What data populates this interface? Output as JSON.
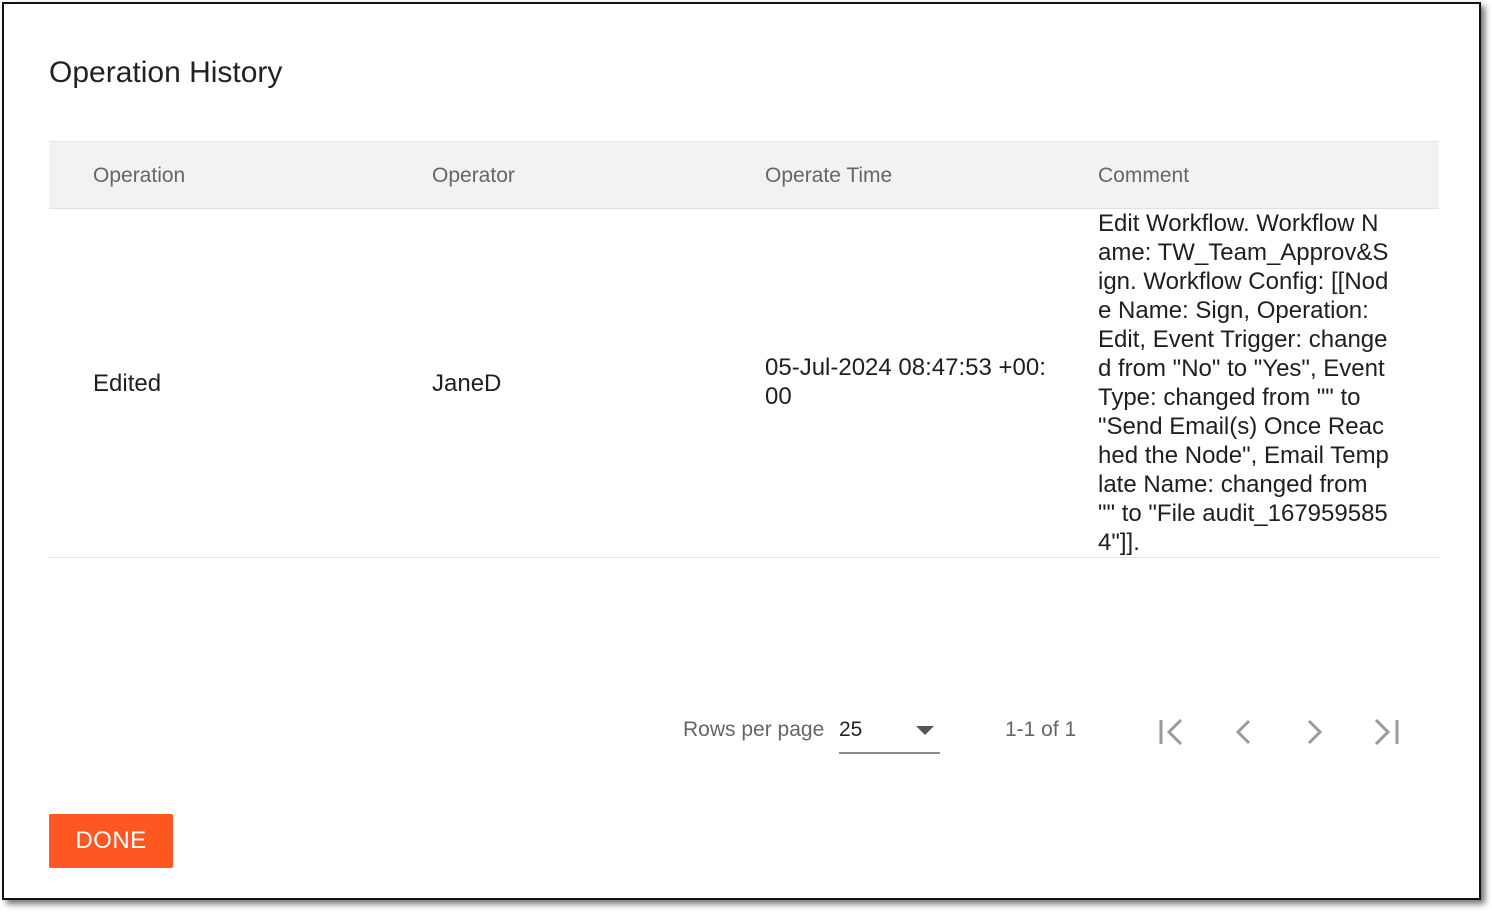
{
  "dialog": {
    "title": "Operation History",
    "done_label": "DONE"
  },
  "table": {
    "columns": [
      "Operation",
      "Operator",
      "Operate Time",
      "Comment"
    ],
    "rows": [
      {
        "operation": "Edited",
        "operator": "JaneD",
        "operate_time": "05-Jul-2024 08:47:53 +00:00",
        "comment": "Edit Workflow. Workflow Name: TW_Team_Approv&Sign. Workflow Config: [[Node Name: Sign, Operation: Edit, Event Trigger: changed from \"No\" to \"Yes\", Event Type: changed from \"\" to \"Send Email(s) Once Reached the Node\", Email Template Name: changed from \"\" to \"File audit_1679595854\"]]."
      }
    ]
  },
  "pagination": {
    "rows_per_page_label": "Rows per page",
    "rows_per_page_value": "25",
    "range_text": "1-1 of 1"
  },
  "colors": {
    "accent": "#ff5722",
    "header_bg": "#f2f2f2"
  },
  "icons": {
    "first_page": "first-page-icon",
    "prev_page": "chevron-left-icon",
    "next_page": "chevron-right-icon",
    "last_page": "last-page-icon",
    "dropdown": "caret-down-icon"
  }
}
